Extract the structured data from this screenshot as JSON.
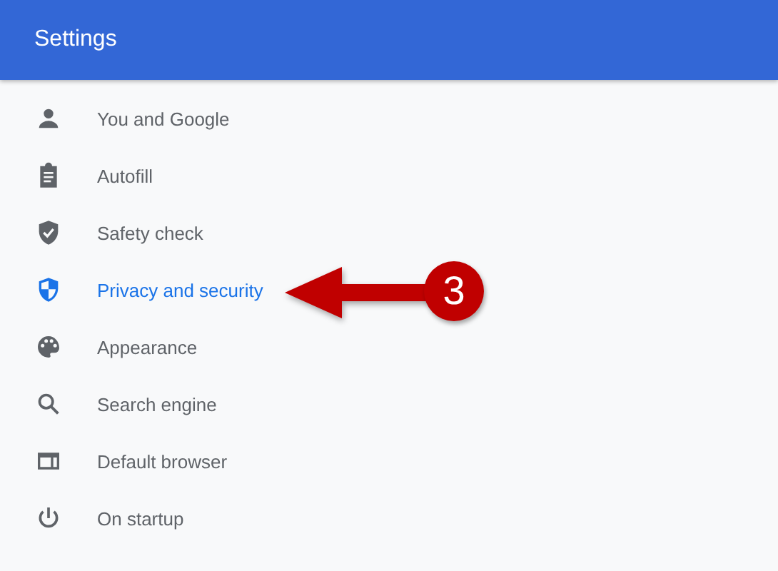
{
  "header": {
    "title": "Settings"
  },
  "menu": [
    {
      "label": "You and Google",
      "kind": "person",
      "selected": false
    },
    {
      "label": "Autofill",
      "kind": "clipboard",
      "selected": false
    },
    {
      "label": "Safety check",
      "kind": "shield-check",
      "selected": false
    },
    {
      "label": "Privacy and security",
      "kind": "shield",
      "selected": true
    },
    {
      "label": "Appearance",
      "kind": "palette",
      "selected": false
    },
    {
      "label": "Search engine",
      "kind": "search",
      "selected": false
    },
    {
      "label": "Default browser",
      "kind": "browser",
      "selected": false
    },
    {
      "label": "On startup",
      "kind": "power",
      "selected": false
    }
  ],
  "callout": {
    "number": "3"
  }
}
